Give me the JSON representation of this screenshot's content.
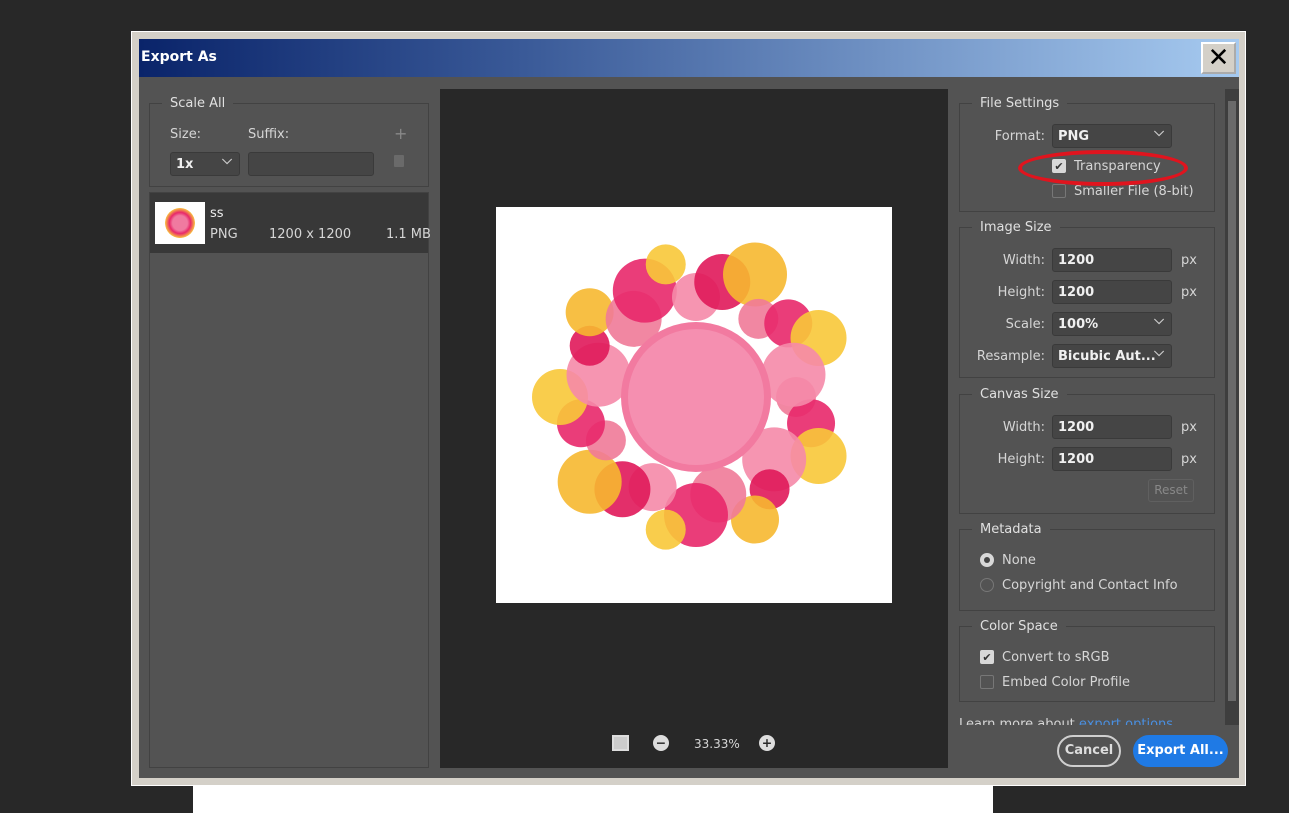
{
  "dialog": {
    "title": "Export As",
    "close_label": "✕"
  },
  "left": {
    "scale_all": "Scale All",
    "size_label": "Size:",
    "suffix_label": "Suffix:",
    "size_value": "1x",
    "suffix_value": "",
    "add_icon": "+",
    "asset": {
      "name": "ss",
      "format": "PNG",
      "dimensions": "1200 x 1200",
      "filesize": "1.1 MB"
    }
  },
  "preview": {
    "zoom": "33.33%"
  },
  "file_settings": {
    "title": "File Settings",
    "format_label": "Format:",
    "format_value": "PNG",
    "transparency": "Transparency",
    "transparency_checked": true,
    "smaller_file": "Smaller File (8-bit)",
    "smaller_file_checked": false
  },
  "image_size": {
    "title": "Image Size",
    "width_label": "Width:",
    "width": "1200",
    "height_label": "Height:",
    "height": "1200",
    "unit": "px",
    "scale_label": "Scale:",
    "scale": "100%",
    "resample_label": "Resample:",
    "resample": "Bicubic Aut..."
  },
  "canvas_size": {
    "title": "Canvas Size",
    "width_label": "Width:",
    "width": "1200",
    "height_label": "Height:",
    "height": "1200",
    "unit": "px",
    "reset": "Reset"
  },
  "metadata": {
    "title": "Metadata",
    "options": [
      "None",
      "Copyright and Contact Info"
    ],
    "selected": "None"
  },
  "color_space": {
    "title": "Color Space",
    "convert": "Convert to sRGB",
    "convert_checked": true,
    "embed": "Embed Color Profile",
    "embed_checked": false
  },
  "learn_more": {
    "text": "Learn more about",
    "link": "export options"
  },
  "buttons": {
    "cancel": "Cancel",
    "export": "Export All..."
  },
  "colors": {
    "accent": "#1f7ae5",
    "annotation": "#e0141e"
  }
}
